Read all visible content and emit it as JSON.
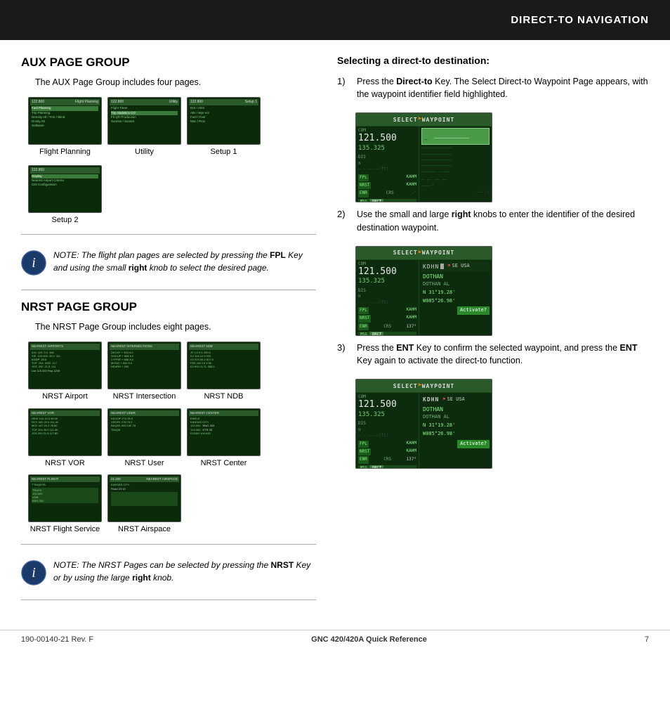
{
  "header": {
    "title": "DIRECT-TO NAVIGATION"
  },
  "left": {
    "aux_title": "AUX PAGE GROUP",
    "aux_desc": "The AUX Page Group includes four pages.",
    "aux_screens": [
      {
        "label": "Flight Planning"
      },
      {
        "label": "Utility"
      },
      {
        "label": "Setup 1"
      },
      {
        "label": "Setup 2"
      }
    ],
    "aux_note": "NOTE:  The flight plan pages are selected by pressing the FPL Key and using the small right knob to select the desired page.",
    "nrst_title": "NRST PAGE GROUP",
    "nrst_desc": "The NRST Page Group includes eight pages.",
    "nrst_screens": [
      {
        "label": "NRST Airport"
      },
      {
        "label": "NRST Intersection"
      },
      {
        "label": "NRST NDB"
      },
      {
        "label": "NRST VOR"
      },
      {
        "label": "NRST User"
      },
      {
        "label": "NRST Center"
      },
      {
        "label": "NRST Flight Service"
      },
      {
        "label": "NRST Airspace"
      }
    ],
    "nrst_note": "NOTE:  The NRST Pages can be selected by pressing the NRST Key or by using the large right knob."
  },
  "right": {
    "title": "Selecting a direct-to destination:",
    "steps": [
      {
        "num": "1)",
        "text": "Press the Direct-to Key.  The Select Direct-to Waypoint Page appears, with the waypoint identifier field highlighted."
      },
      {
        "num": "2)",
        "text": "Use the small and large right knobs to enter the identifier of the desired destination waypoint."
      },
      {
        "num": "3)",
        "text": "Press the ENT Key to confirm the selected waypoint, and press the ENT Key again to activate the direct-to function."
      }
    ],
    "gps1": {
      "header": "SELECT",
      "arrow": "➤",
      "waypoint": "WAYPOINT",
      "com": "COM",
      "freq1": "121.500",
      "freq2": "135.325",
      "dis": "DIS",
      "n": "n",
      "fpl": "FPL",
      "kahm1": "KAHM",
      "nrst": "NRST",
      "kahm2": "KAHM",
      "enr": "ENR",
      "crs": "CRS",
      "msg": "MSG",
      "drct": "DRCT"
    },
    "gps2": {
      "header": "SELECT",
      "arrow": "➤",
      "waypoint": "WAYPOINT",
      "com": "COM",
      "freq1": "121.500",
      "freq2": "135.325",
      "id_entry": "KDHN_",
      "flag": "SE USA",
      "name1": "DOTHAN",
      "name2": "DOTHAN AL",
      "fpl": "FPL",
      "kahm1": "KAHM",
      "nrst": "NRST",
      "kahm2": "KAHM",
      "enr": "ENR",
      "crs": "CRS",
      "crs_val": "137°",
      "coords1": "N 31°19.28'",
      "coords2": "W085°26.98'",
      "activate": "Activate?",
      "msg": "MSG",
      "drct": "DRCT"
    },
    "gps3": {
      "header": "SELECT",
      "arrow": "➤",
      "waypoint": "WAYPOINT",
      "com": "COM",
      "freq1": "121.500",
      "freq2": "135.325",
      "id_entry": "KDHN",
      "flag": "SE USA",
      "name1": "DOTHAN",
      "name2": "DOTHAN AL",
      "fpl": "FPL",
      "kahm1": "KAHM",
      "nrst": "NRST",
      "kahm2": "KAHM",
      "enr": "ENR",
      "crs": "CRS",
      "crs_val": "137°",
      "coords1": "N 31°19.28'",
      "coords2": "W085°26.98'",
      "activate": "Activate?",
      "msg": "MSG",
      "drct": "DRCT"
    }
  },
  "footer": {
    "left": "190-00140-21  Rev. F",
    "center": "GNC 420/420A Quick Reference",
    "right": "7"
  }
}
